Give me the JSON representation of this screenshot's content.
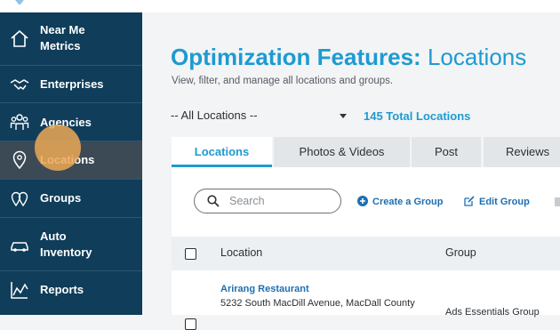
{
  "sidebar": {
    "items": [
      {
        "label": "Near Me Metrics",
        "icon": "home-icon",
        "active": false
      },
      {
        "label": "Enterprises",
        "icon": "handshake-icon",
        "active": false
      },
      {
        "label": "Agencies",
        "icon": "people-icon",
        "active": false
      },
      {
        "label": "Locations",
        "icon": "map-pin-icon",
        "active": true
      },
      {
        "label": "Groups",
        "icon": "pin-group-icon",
        "active": false
      },
      {
        "label": "Auto Inventory",
        "icon": "car-icon",
        "active": false
      },
      {
        "label": "Reports",
        "icon": "chart-icon",
        "active": false
      }
    ]
  },
  "header": {
    "title_bold": "Optimization Features:",
    "title_light": "Locations",
    "subtitle": "View, filter, and manage all locations and groups."
  },
  "filter": {
    "selected": "-- All Locations --",
    "total": "145 Total Locations"
  },
  "tabs": [
    {
      "label": "Locations",
      "active": true
    },
    {
      "label": "Photos & Videos",
      "active": false
    },
    {
      "label": "Post",
      "active": false
    },
    {
      "label": "Reviews",
      "active": false
    }
  ],
  "toolbar": {
    "search_placeholder": "Search",
    "create_group": "Create a Group",
    "edit_group": "Edit Group"
  },
  "table": {
    "columns": [
      "Location",
      "Group"
    ],
    "rows": [
      {
        "name": "Arirang Restaurant",
        "address": "5232 South MacDill Avenue, MacDall County",
        "group": "Ads Essentials Group"
      }
    ]
  },
  "colors": {
    "sidebar_bg": "#0f3d5a",
    "accent": "#1d9bd1",
    "link": "#1d6fb3",
    "highlight": "#eca856"
  }
}
